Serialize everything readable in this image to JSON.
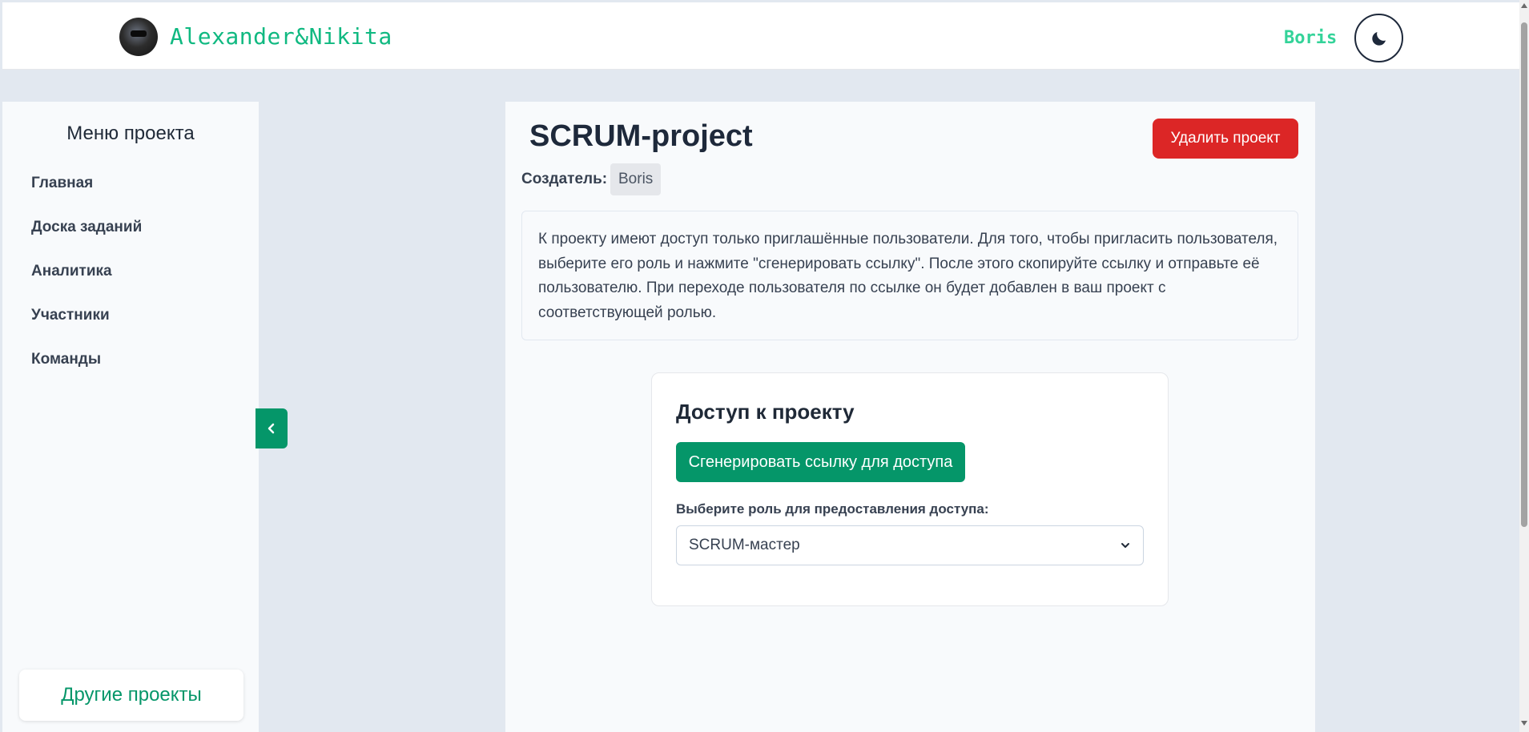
{
  "header": {
    "brand": "Alexander&Nikita",
    "username": "Boris",
    "logo_icon": "avatar-logo",
    "theme_icon": "moon-icon"
  },
  "sidebar": {
    "title": "Меню проекта",
    "items": [
      {
        "label": "Главная"
      },
      {
        "label": "Доска заданий"
      },
      {
        "label": "Аналитика"
      },
      {
        "label": "Участники"
      },
      {
        "label": "Команды"
      }
    ],
    "other_projects": "Другие проекты",
    "collapse_icon": "chevron-left-icon"
  },
  "project": {
    "title": "SCRUM-project",
    "delete_label": "Удалить проект",
    "creator_label": "Создатель:",
    "creator_name": "Boris",
    "info_text": "К проекту имеют доступ только приглашённые пользователи. Для того, чтобы пригласить пользователя, выберите его роль и нажмите \"сгенерировать ссылку\". После этого скопируйте ссылку и отправьте её пользователю. При переходе пользователя по ссылке он будет добавлен в ваш проект с соответствующей ролью."
  },
  "access_card": {
    "title": "Доступ к проекту",
    "generate_label": "Сгенерировать ссылку для доступа",
    "role_label": "Выберите роль для предоставления доступа:",
    "role_selected": "SCRUM-мастер"
  },
  "colors": {
    "accent": "#059669",
    "brand_text": "#10b981",
    "danger": "#dc2626",
    "background": "#e2e8f0"
  }
}
